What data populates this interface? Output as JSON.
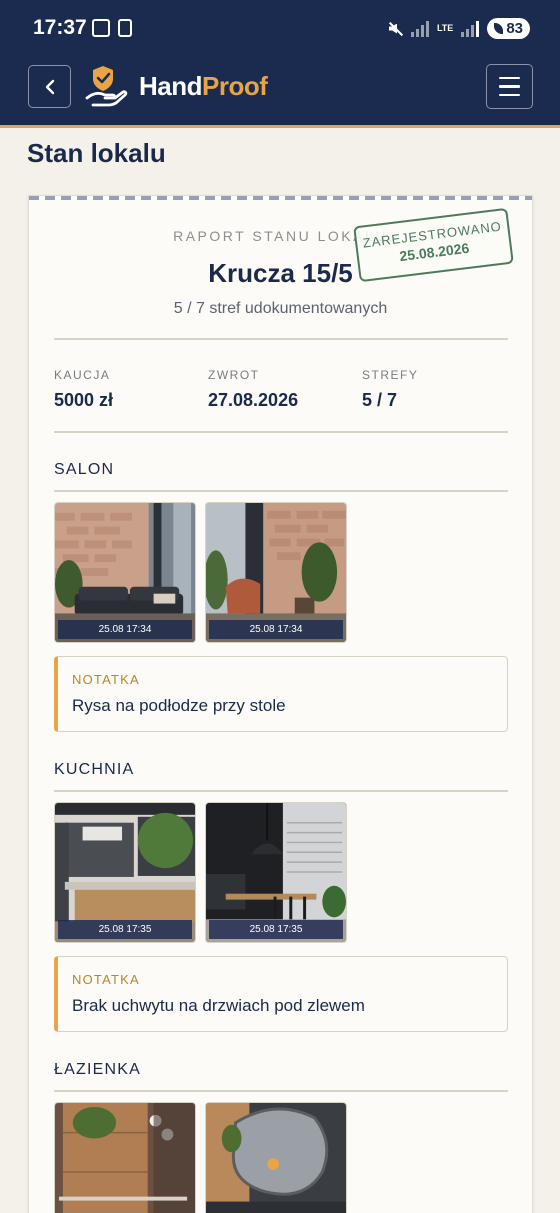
{
  "status_bar": {
    "time": "17:37",
    "network": "LTE",
    "battery": "83"
  },
  "header": {
    "brand_first": "Hand",
    "brand_second": "Proof",
    "brand_color": "#e8a545",
    "nav_color": "#1b2a4f"
  },
  "page": {
    "title": "Stan lokalu"
  },
  "report": {
    "label": "RAPORT STANU LOKALU",
    "address": "Krucza 15/5",
    "zones_summary": "5 / 7 stref udokumentowanych",
    "stamp": {
      "label": "ZAREJESTROWANO",
      "date": "25.08.2026",
      "color": "#4e7a5c"
    },
    "stats": [
      {
        "label": "KAUCJA",
        "value": "5000 zł"
      },
      {
        "label": "ZWROT",
        "value": "27.08.2026"
      },
      {
        "label": "STREFY",
        "value": "5 / 7"
      }
    ],
    "sections": [
      {
        "title": "SALON",
        "photos": [
          {
            "timestamp": "25.08 17:34",
            "scene": "living-room-sofa-brick-wall"
          },
          {
            "timestamp": "25.08 17:34",
            "scene": "living-room-armchair-plant"
          }
        ],
        "note": {
          "label": "NOTATKA",
          "text": "Rysa na podłodze przy stole"
        }
      },
      {
        "title": "KUCHNIA",
        "photos": [
          {
            "timestamp": "25.08 17:35",
            "scene": "kitchen-cabinets"
          },
          {
            "timestamp": "25.08 17:35",
            "scene": "kitchen-dining-table-lamp"
          }
        ],
        "note": {
          "label": "NOTATKA",
          "text": "Brak uchwytu na drzwiach pod zlewem"
        }
      },
      {
        "title": "ŁAZIENKA",
        "photos": [
          {
            "timestamp": "",
            "scene": "bathroom-wood-panel"
          },
          {
            "timestamp": "",
            "scene": "bathroom-mirror"
          }
        ]
      }
    ]
  }
}
